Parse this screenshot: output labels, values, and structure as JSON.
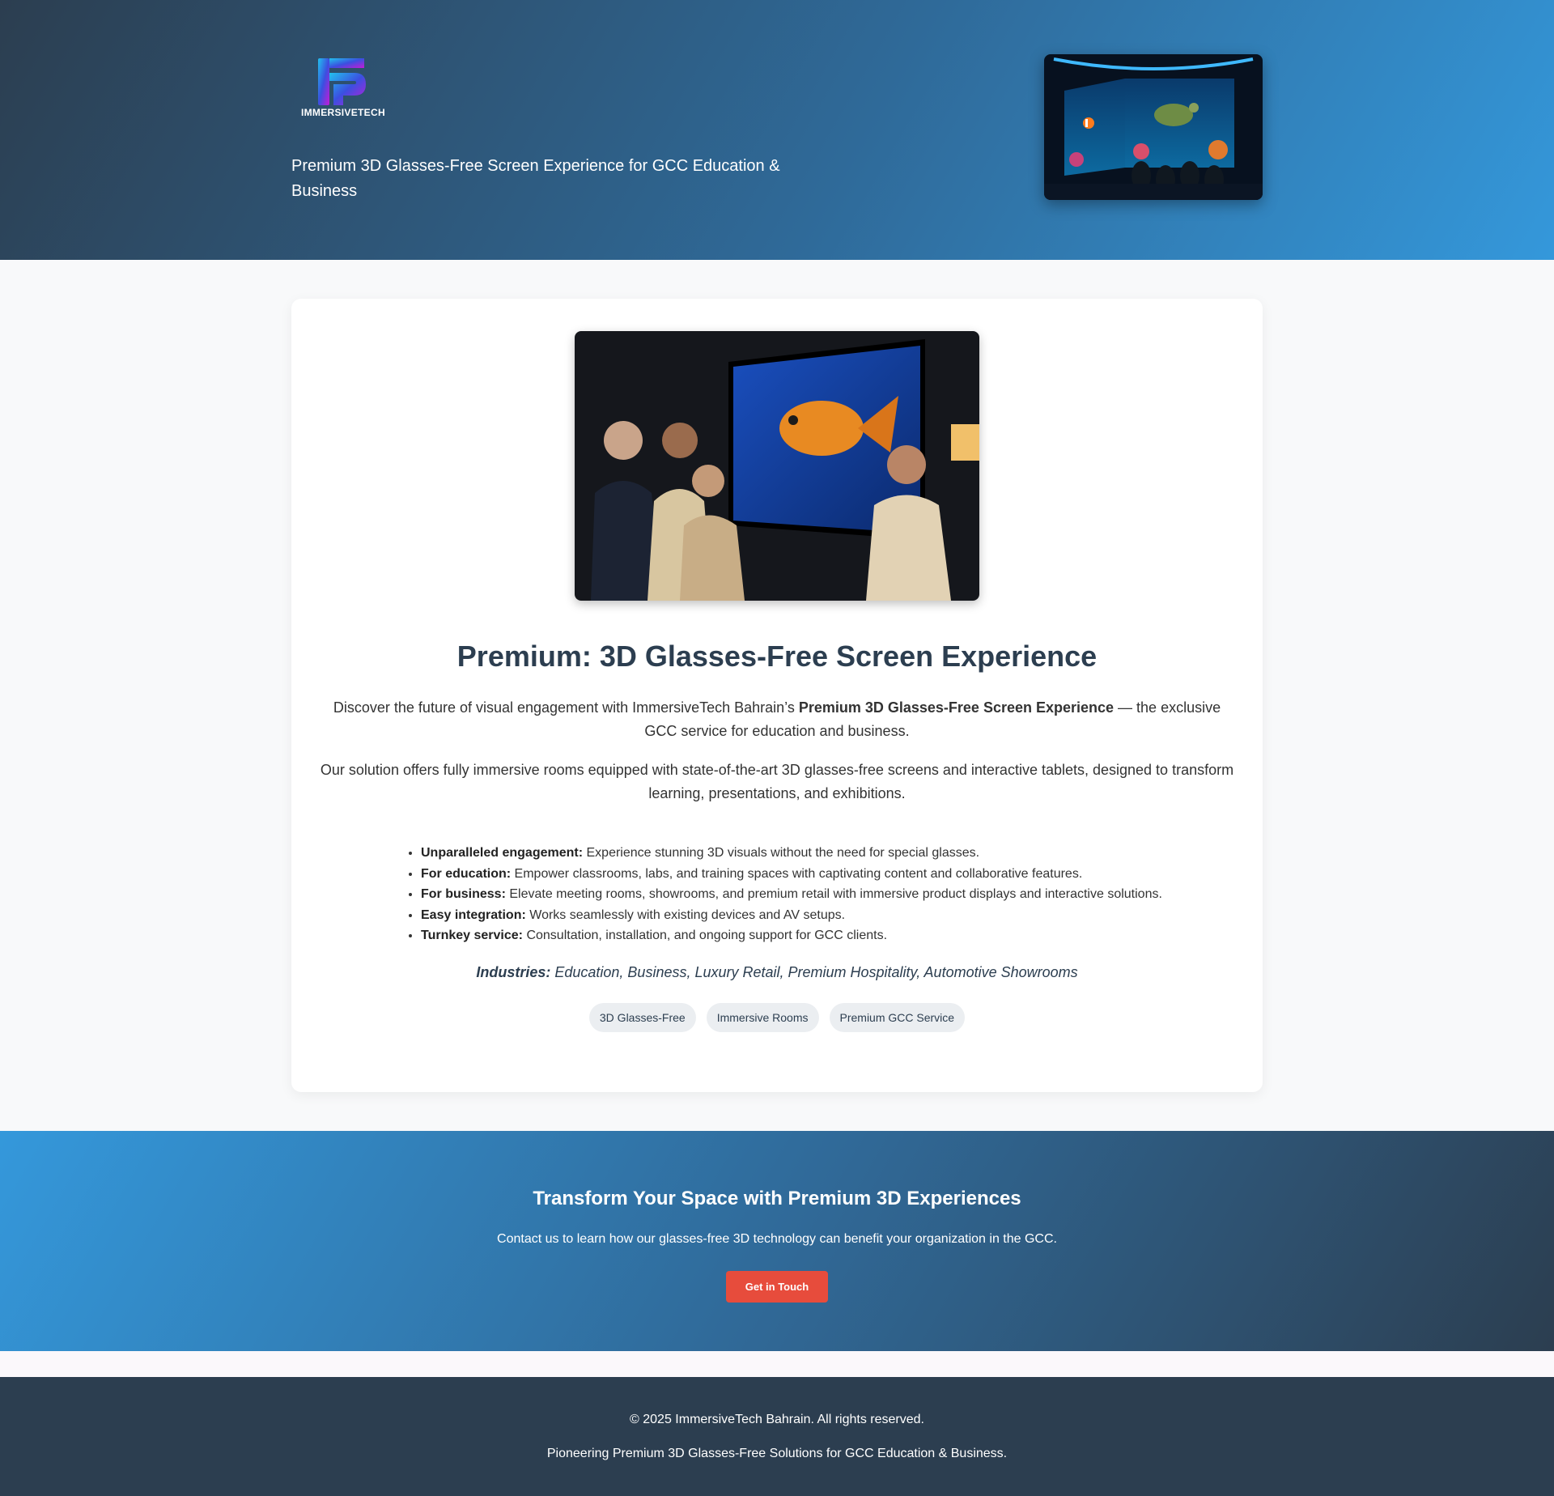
{
  "header": {
    "logo_text": "IMMERSIVETECH",
    "tagline": "Premium 3D Glasses-Free Screen Experience for GCC Education & Business",
    "image_alt": "Immersive aquarium room with sea turtle and clownfish"
  },
  "main": {
    "image_alt": "Family watching a glasses-free 3D goldfish on screen",
    "title": "Premium: 3D Glasses-Free Screen Experience",
    "intro_before": "Discover the future of visual engagement with ImmersiveTech Bahrain’s ",
    "intro_bold": "Premium 3D Glasses-Free Screen Experience",
    "intro_after": " — the exclusive GCC service for education and business.",
    "paragraph2": "Our solution offers fully immersive rooms equipped with state-of-the-art 3D glasses-free screens and interactive tablets, designed to transform learning, presentations, and exhibitions.",
    "features": [
      {
        "label": "Unparalleled engagement:",
        "text": " Experience stunning 3D visuals without the need for special glasses."
      },
      {
        "label": "For education:",
        "text": " Empower classrooms, labs, and training spaces with captivating content and collaborative features."
      },
      {
        "label": "For business:",
        "text": " Elevate meeting rooms, showrooms, and premium retail with immersive product displays and interactive solutions."
      },
      {
        "label": "Easy integration:",
        "text": " Works seamlessly with existing devices and AV setups."
      },
      {
        "label": "Turnkey service:",
        "text": " Consultation, installation, and ongoing support for GCC clients."
      }
    ],
    "industries_label": "Industries:",
    "industries_text": " Education, Business, Luxury Retail, Premium Hospitality, Automotive Showrooms",
    "tags": [
      "3D Glasses-Free",
      "Immersive Rooms",
      "Premium GCC Service"
    ]
  },
  "cta": {
    "title": "Transform Your Space with Premium 3D Experiences",
    "text": "Contact us to learn how our glasses-free 3D technology can benefit your organization in the GCC.",
    "button": "Get in Touch"
  },
  "footer": {
    "copyright": "© 2025 ImmersiveTech Bahrain. All rights reserved.",
    "tagline": "Pioneering Premium 3D Glasses-Free Solutions for GCC Education & Business."
  },
  "colors": {
    "primary": "#2c3e50",
    "accent": "#3498db",
    "button": "#e74c3c"
  }
}
